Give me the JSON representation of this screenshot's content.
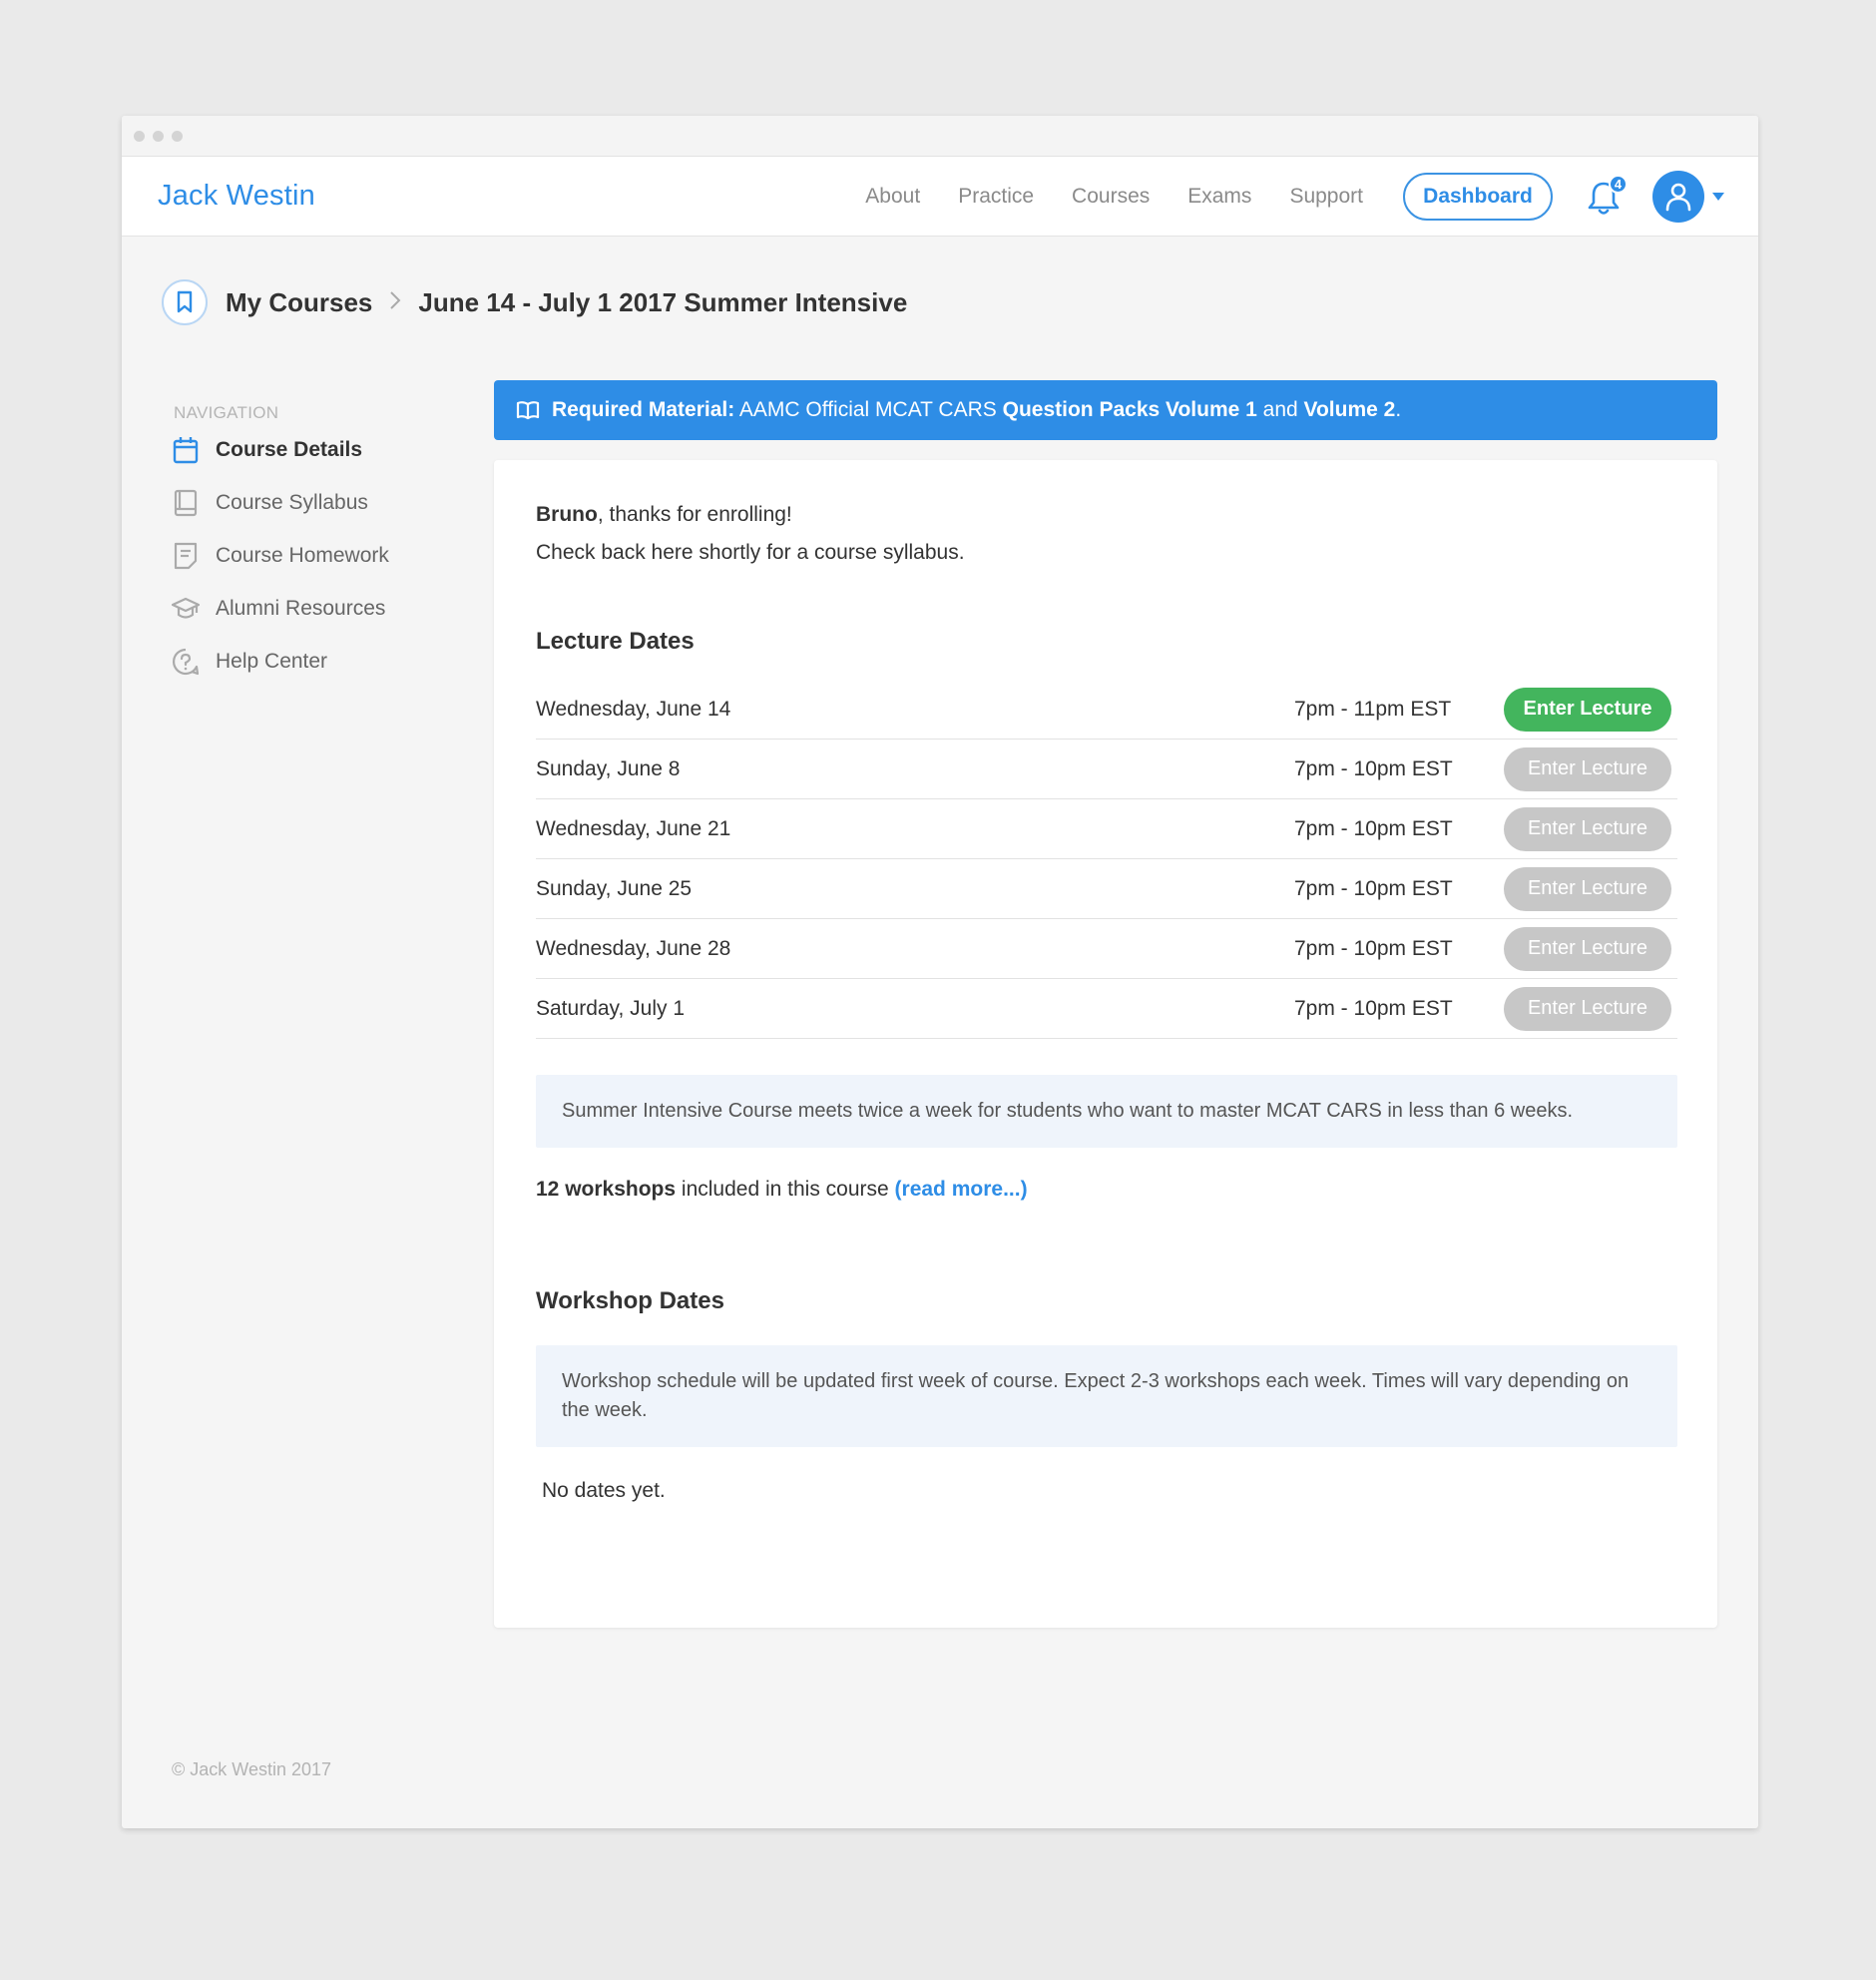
{
  "header": {
    "brand": "Jack Westin",
    "nav": [
      "About",
      "Practice",
      "Courses",
      "Exams",
      "Support"
    ],
    "dashboard_label": "Dashboard",
    "notification_count": "4"
  },
  "breadcrumb": {
    "parent": "My Courses",
    "current": "June 14 - July 1 2017 Summer Intensive"
  },
  "sidebar": {
    "heading": "NAVIGATION",
    "items": [
      {
        "label": "Course Details",
        "icon": "calendar-icon",
        "active": true
      },
      {
        "label": "Course Syllabus",
        "icon": "book-icon",
        "active": false
      },
      {
        "label": "Course Homework",
        "icon": "document-icon",
        "active": false
      },
      {
        "label": "Alumni Resources",
        "icon": "graduation-cap-icon",
        "active": false
      },
      {
        "label": "Help Center",
        "icon": "help-icon",
        "active": false
      }
    ]
  },
  "banner": {
    "label": "Required Material:",
    "text_1": " AAMC Official MCAT CARS ",
    "bold_1": "Question Packs Volume 1",
    "text_2": " and ",
    "bold_2": "Volume 2",
    "text_3": "."
  },
  "course": {
    "user_name": "Bruno",
    "greeting_rest": ", thanks for enrolling!",
    "syllabus_note": "Check back here shortly for a course syllabus.",
    "lecture_title": "Lecture Dates",
    "lectures": [
      {
        "date": "Wednesday, June 14",
        "time": "7pm - 11pm EST",
        "button": "Enter Lecture",
        "enabled": true
      },
      {
        "date": "Sunday, June 8",
        "time": "7pm - 10pm EST",
        "button": "Enter Lecture",
        "enabled": false
      },
      {
        "date": "Wednesday, June 21",
        "time": "7pm - 10pm EST",
        "button": "Enter Lecture",
        "enabled": false
      },
      {
        "date": "Sunday, June 25",
        "time": "7pm - 10pm EST",
        "button": "Enter Lecture",
        "enabled": false
      },
      {
        "date": "Wednesday, June 28",
        "time": "7pm - 10pm EST",
        "button": "Enter Lecture",
        "enabled": false
      },
      {
        "date": "Saturday, July 1",
        "time": "7pm - 10pm EST",
        "button": "Enter Lecture",
        "enabled": false
      }
    ],
    "description": "Summer Intensive Course meets twice a week for students who want to master MCAT CARS in less than 6 weeks.",
    "workshops_count": "12 workshops",
    "workshops_rest": " included in this course ",
    "read_more": "(read more...)",
    "workshop_title": "Workshop Dates",
    "workshop_note": "Workshop schedule will be updated first week of course. Expect 2-3 workshops each week. Times will vary depending on the week.",
    "no_dates": "No dates yet."
  },
  "footer": "© Jack Westin 2017",
  "colors": {
    "brand_blue": "#2e8de6",
    "success_green": "#43b55d",
    "disabled_gray": "#c7c7c7",
    "info_bg": "#eff4fb"
  }
}
